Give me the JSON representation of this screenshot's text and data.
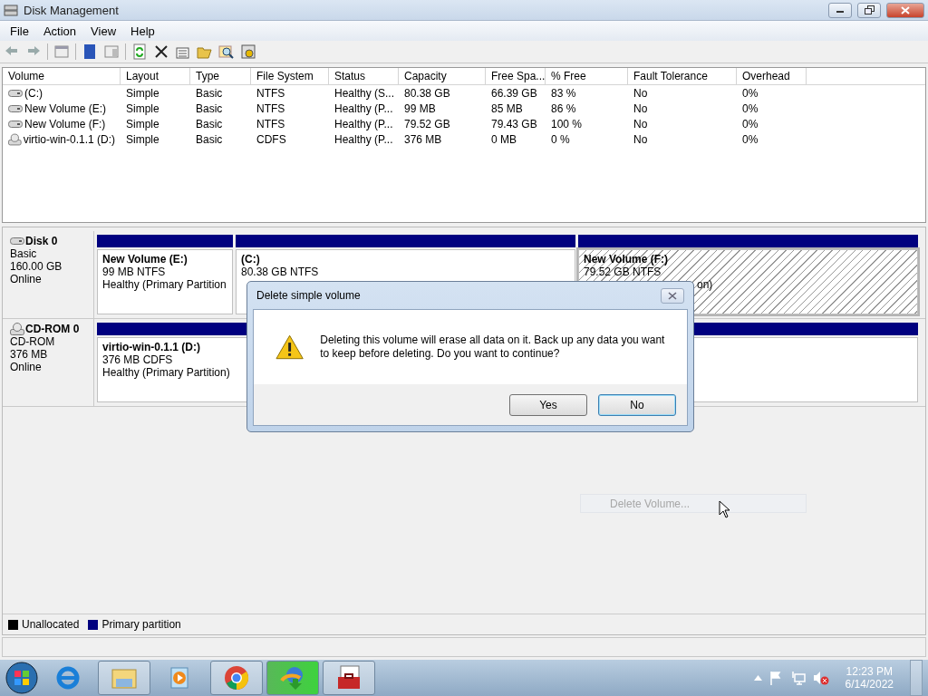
{
  "window": {
    "title": "Disk Management"
  },
  "menu": [
    "File",
    "Action",
    "View",
    "Help"
  ],
  "volumes": {
    "columns": [
      "Volume",
      "Layout",
      "Type",
      "File System",
      "Status",
      "Capacity",
      "Free Spa...",
      "% Free",
      "Fault Tolerance",
      "Overhead"
    ],
    "rows": [
      {
        "kind": "disk",
        "cells": [
          "(C:)",
          "Simple",
          "Basic",
          "NTFS",
          "Healthy (S...",
          "80.38 GB",
          "66.39 GB",
          "83 %",
          "No",
          "0%"
        ]
      },
      {
        "kind": "disk",
        "cells": [
          "New Volume (E:)",
          "Simple",
          "Basic",
          "NTFS",
          "Healthy (P...",
          "99 MB",
          "85 MB",
          "86 %",
          "No",
          "0%"
        ]
      },
      {
        "kind": "disk",
        "cells": [
          "New Volume (F:)",
          "Simple",
          "Basic",
          "NTFS",
          "Healthy (P...",
          "79.52 GB",
          "79.43 GB",
          "100 %",
          "No",
          "0%"
        ]
      },
      {
        "kind": "cdrom",
        "cells": [
          "virtio-win-0.1.1 (D:)",
          "Simple",
          "Basic",
          "CDFS",
          "Healthy (P...",
          "376 MB",
          "0 MB",
          "0 %",
          "No",
          "0%"
        ]
      }
    ]
  },
  "disks": [
    {
      "kind": "disk",
      "name": "Disk 0",
      "type": "Basic",
      "size": "160.00 GB",
      "status": "Online",
      "partitions": [
        {
          "name": "New Volume  (E:)",
          "size": "99 MB NTFS",
          "status": "Healthy (Primary Partition",
          "selected": false
        },
        {
          "name": " (C:)",
          "size": "80.38 GB NTFS",
          "selected": false
        },
        {
          "name": "New Volume  (F:)",
          "size": "79.52 GB NTFS",
          "status": "on)",
          "selected": true
        }
      ]
    },
    {
      "kind": "cdrom",
      "name": "CD-ROM 0",
      "type": "CD-ROM",
      "size": "376 MB",
      "status": "Online",
      "partitions": [
        {
          "name": "virtio-win-0.1.1  (D:)",
          "size": "376 MB CDFS",
          "status": "Healthy (Primary Partition)",
          "selected": false
        }
      ]
    }
  ],
  "legend": [
    {
      "label": "Unallocated",
      "color": "#000000"
    },
    {
      "label": "Primary partition",
      "color": "#00007f"
    }
  ],
  "context_menu": {
    "label": "Delete Volume...",
    "disabled": true
  },
  "dialog": {
    "title": "Delete simple volume",
    "message": "Deleting this volume will erase all data on it. Back up any data you want to keep before deleting. Do you want to continue?",
    "buttons": [
      {
        "label": "Yes",
        "default": false
      },
      {
        "label": "No",
        "default": true
      }
    ]
  },
  "taskbar": {
    "time": "12:23 PM",
    "date": "6/14/2022"
  }
}
